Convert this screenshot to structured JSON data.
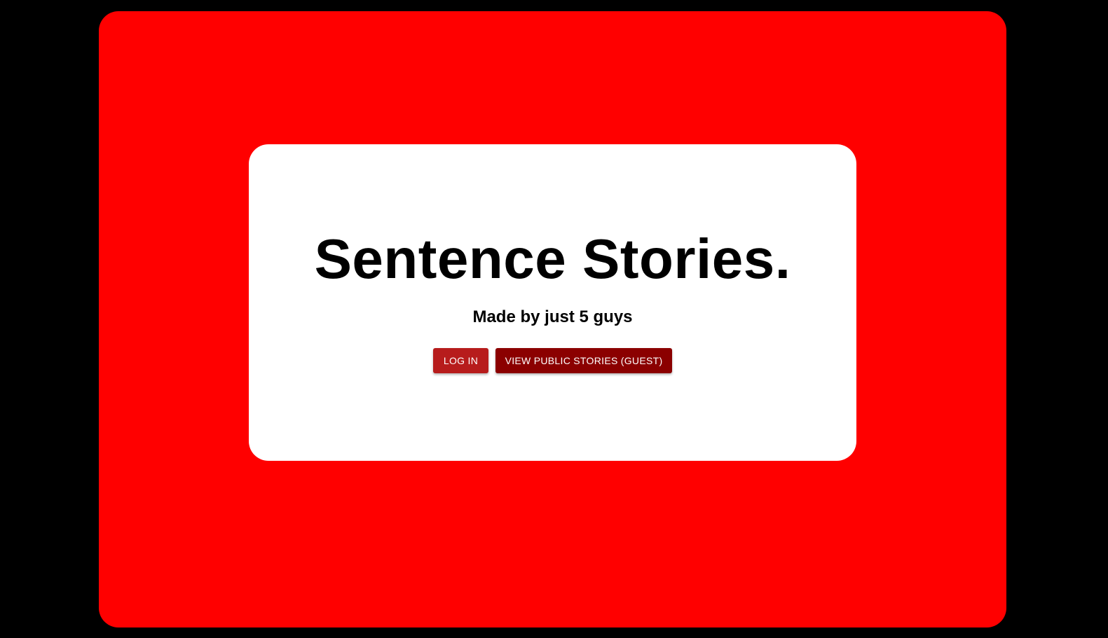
{
  "landing": {
    "title": "Sentence Stories.",
    "subtitle": "Made by just 5 guys",
    "login_label": "LOG IN",
    "guest_label": "VIEW PUBLIC STORIES (GUEST)"
  },
  "colors": {
    "page_background": "#000000",
    "outer_panel": "#ff0000",
    "card": "#ffffff",
    "login_button": "#b71c1c",
    "guest_button": "#8b0000"
  }
}
